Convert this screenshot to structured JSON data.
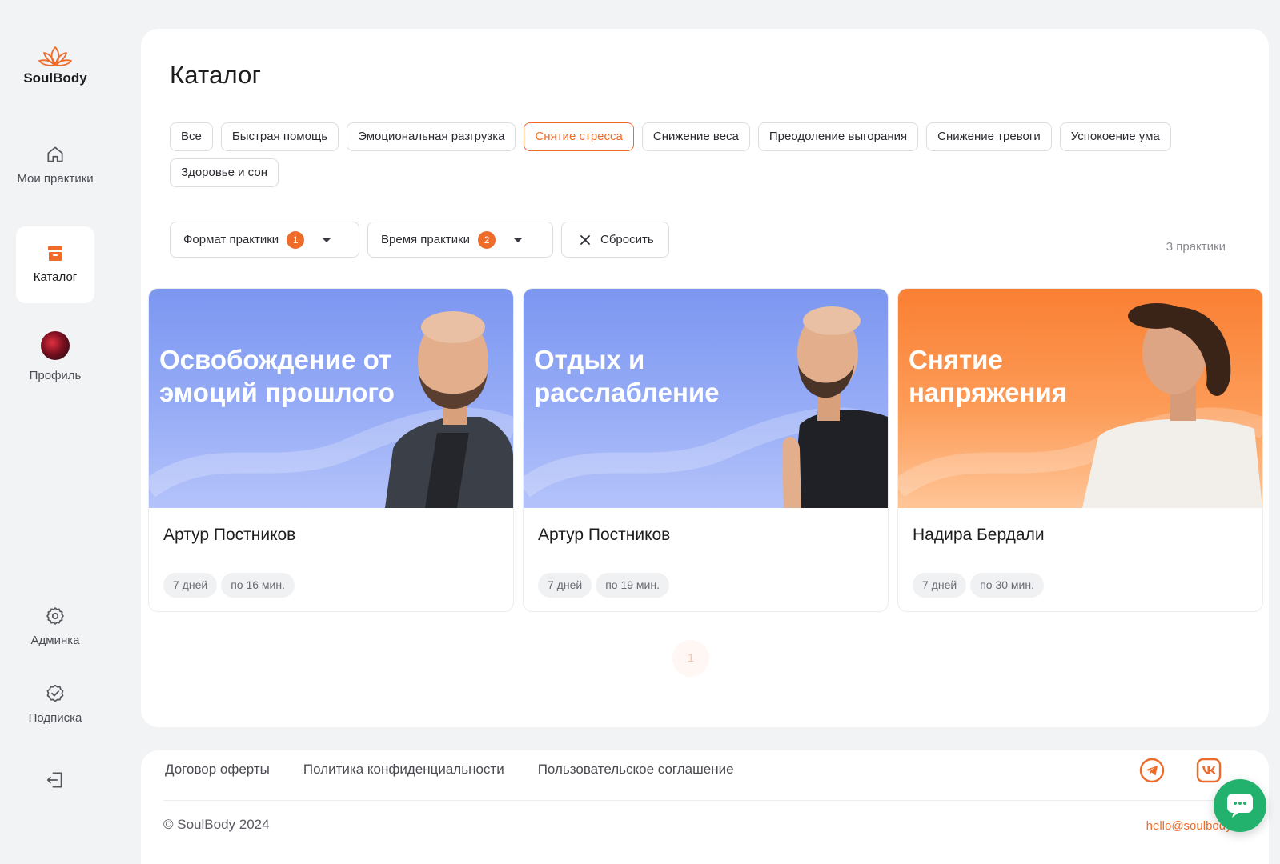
{
  "brand": {
    "name": "SoulBody",
    "accent": "#ef6b2a"
  },
  "sidebar": {
    "items": [
      {
        "label": "Мои практики",
        "icon": "home-icon"
      },
      {
        "label": "Каталог",
        "icon": "catalog-box-icon",
        "active": true
      },
      {
        "label": "Профиль",
        "icon": "avatar"
      },
      {
        "label": "Админка",
        "icon": "gear-icon"
      },
      {
        "label": "Подписка",
        "icon": "verified-badge-icon"
      }
    ],
    "logout_icon": "logout-icon"
  },
  "main": {
    "title": "Каталог",
    "chips": [
      {
        "label": "Все"
      },
      {
        "label": "Быстрая помощь"
      },
      {
        "label": "Эмоциональная разгрузка"
      },
      {
        "label": "Снятие стресса",
        "selected": true
      },
      {
        "label": "Снижение веса"
      },
      {
        "label": "Преодоление выгорания"
      },
      {
        "label": "Снижение тревоги"
      },
      {
        "label": "Успокоение ума"
      },
      {
        "label": "Здоровье и сон"
      }
    ],
    "filters": {
      "format": {
        "label": "Формат практики",
        "count": "1"
      },
      "time": {
        "label": "Время практики",
        "count": "2"
      },
      "reset": {
        "label": "Сбросить"
      }
    },
    "result_count": "3 практики",
    "cards": [
      {
        "title": "Освобождение от эмоций прошлого",
        "author": "Артур Постников",
        "days": "7 дней",
        "duration": "по 16 мин.",
        "theme": "blue"
      },
      {
        "title": "Отдых и расслабление",
        "author": "Артур Постников",
        "days": "7 дней",
        "duration": "по 19 мин.",
        "theme": "blue"
      },
      {
        "title": "Снятие напряжения",
        "author": "Надира Бердали",
        "days": "7 дней",
        "duration": "по 30 мин.",
        "theme": "orange"
      }
    ],
    "pagination": {
      "current": "1"
    }
  },
  "footer": {
    "links": [
      "Договор оферты",
      "Политика конфиденциальности",
      "Пользовательское соглашение"
    ],
    "copyright": "© SoulBody 2024",
    "email": "hello@soulbody.ru",
    "social": [
      "telegram-icon",
      "vk-icon"
    ]
  }
}
